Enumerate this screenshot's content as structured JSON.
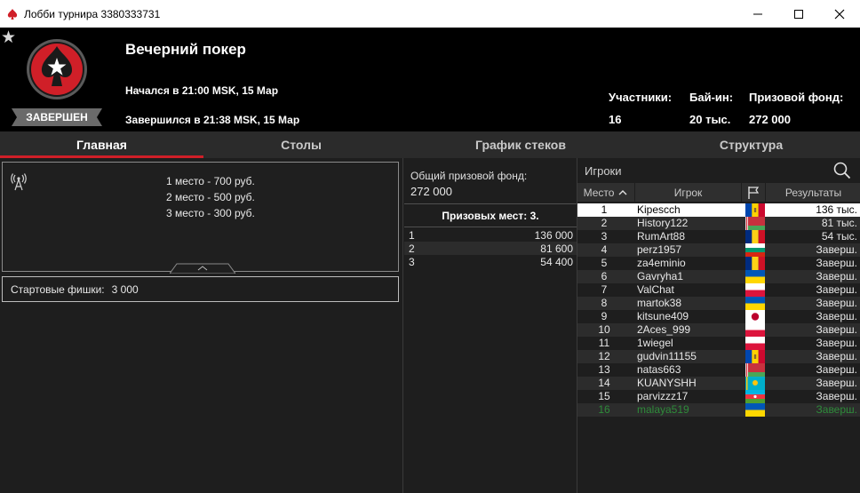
{
  "window": {
    "title": "Лобби турнира 3380333731"
  },
  "header": {
    "name": "Вечерний покер",
    "started": "Начался в 21:00 MSK, 15 Мар",
    "ended": "Завершился в 21:38 MSK, 15 Мар",
    "status": "ЗАВЕРШЕН",
    "stats": [
      {
        "label": "Участники:",
        "value": "16"
      },
      {
        "label": "Бай-ин:",
        "value": "20 тыс."
      },
      {
        "label": "Призовой фонд:",
        "value": "272 000"
      }
    ]
  },
  "tabs": [
    {
      "label": "Главная",
      "active": true
    },
    {
      "label": "Столы",
      "active": false
    },
    {
      "label": "График стеков",
      "active": false
    },
    {
      "label": "Структура",
      "active": false
    }
  ],
  "main": {
    "prizes": [
      "1 место - 700 руб.",
      "2 место - 500 руб.",
      "3 место - 300 руб."
    ],
    "starting_chips_label": "Стартовые фишки:",
    "starting_chips_value": "3 000"
  },
  "payouts": {
    "pool_label": "Общий призовой фонд:",
    "pool_value": "272 000",
    "paid_places_label": "Призовых мест: 3.",
    "rows": [
      {
        "place": "1",
        "amount": "136 000"
      },
      {
        "place": "2",
        "amount": "81 600"
      },
      {
        "place": "3",
        "amount": "54 400"
      }
    ]
  },
  "players": {
    "title": "Игроки",
    "columns": {
      "place": "Место",
      "player": "Игрок",
      "results": "Результаты"
    },
    "rows": [
      {
        "place": "1",
        "name": "Kipescch",
        "flag": "md",
        "result": "136 тыс.",
        "selected": true
      },
      {
        "place": "2",
        "name": "History122",
        "flag": "by",
        "result": "81 тыс."
      },
      {
        "place": "3",
        "name": "RumArt88",
        "flag": "ro",
        "result": "54 тыс."
      },
      {
        "place": "4",
        "name": "perz1957",
        "flag": "bg",
        "result": "Заверш."
      },
      {
        "place": "5",
        "name": "za4eminio",
        "flag": "ro",
        "result": "Заверш."
      },
      {
        "place": "6",
        "name": "Gavryha1",
        "flag": "ua",
        "result": "Заверш."
      },
      {
        "place": "7",
        "name": "ValChat",
        "flag": "pl",
        "result": "Заверш."
      },
      {
        "place": "8",
        "name": "martok38",
        "flag": "ua",
        "result": "Заверш."
      },
      {
        "place": "9",
        "name": "kitsune409",
        "flag": "jp",
        "result": "Заверш."
      },
      {
        "place": "10",
        "name": "2Aces_999",
        "flag": "pl",
        "result": "Заверш."
      },
      {
        "place": "11",
        "name": "1wiegel",
        "flag": "pl",
        "result": "Заверш."
      },
      {
        "place": "12",
        "name": "gudvin11155",
        "flag": "md",
        "result": "Заверш."
      },
      {
        "place": "13",
        "name": "natas663",
        "flag": "by",
        "result": "Заверш."
      },
      {
        "place": "14",
        "name": "KUANYSHH",
        "flag": "kz",
        "result": "Заверш."
      },
      {
        "place": "15",
        "name": "parvizzz17",
        "flag": "az",
        "result": "Заверш."
      },
      {
        "place": "16",
        "name": "malaya519",
        "flag": "ua",
        "result": "Заверш.",
        "highlight": true
      }
    ]
  },
  "colors": {
    "accent_red": "#d01f28",
    "selected_row": "#ffffff",
    "row_alt": "#2c2c2c",
    "highlight_green": "#2e8b3a"
  },
  "icons": {
    "app": "pokerstars-spade-icon",
    "favorite": "star-icon",
    "broadcast": "antenna-icon",
    "search": "search-icon",
    "flag_column": "flag-icon",
    "sort": "chevron-up-icon"
  }
}
